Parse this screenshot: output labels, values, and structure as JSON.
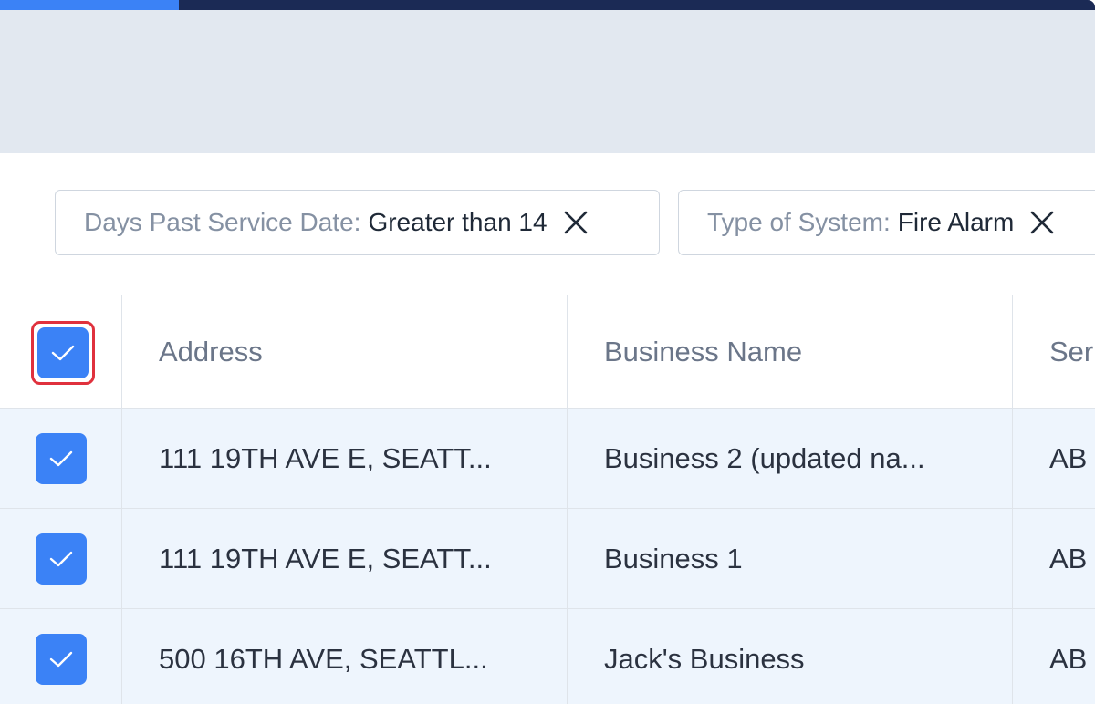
{
  "progress": {
    "fraction": 0.163
  },
  "colors": {
    "accent": "#3b82f6",
    "highlight": "#e0313d",
    "topbar": "#1b2a55",
    "row_selected": "#eef5fd"
  },
  "filters": [
    {
      "key": "Days Past Service Date:",
      "value": "Greater than 14",
      "icon": "close-icon"
    },
    {
      "key": "Type of System:",
      "value": "Fire Alarm",
      "icon": "close-icon"
    }
  ],
  "table": {
    "columns": [
      "Address",
      "Business Name",
      "Ser"
    ],
    "rows": [
      {
        "address": "111 19TH AVE E, SEATT...",
        "business": "Business 2 (updated na...",
        "ser": "AB",
        "checked": true
      },
      {
        "address": "111 19TH AVE E, SEATT...",
        "business": "Business 1",
        "ser": "AB",
        "checked": true
      },
      {
        "address": "500 16TH AVE, SEATTL...",
        "business": "Jack's Business",
        "ser": "AB",
        "checked": true
      }
    ],
    "select_all_checked": true
  }
}
